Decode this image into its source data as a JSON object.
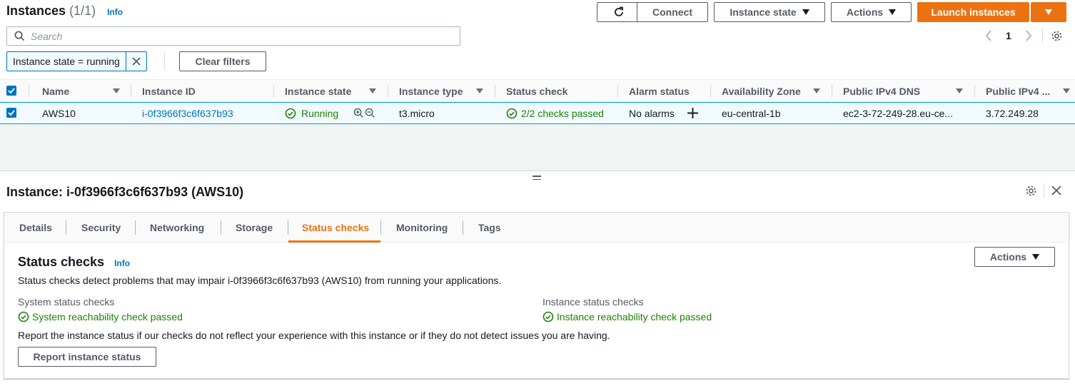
{
  "header": {
    "title": "Instances",
    "count": "(1/1)",
    "info": "Info",
    "connect": "Connect",
    "instance_state": "Instance state",
    "actions": "Actions",
    "launch": "Launch instances"
  },
  "search": {
    "placeholder": "Search"
  },
  "filter": {
    "token": "Instance state = running",
    "clear": "Clear filters"
  },
  "pagination": {
    "page": "1"
  },
  "table": {
    "columns": [
      "Name",
      "Instance ID",
      "Instance state",
      "Instance type",
      "Status check",
      "Alarm status",
      "Availability Zone",
      "Public IPv4 DNS",
      "Public IPv4 ..."
    ],
    "rows": [
      {
        "name": "AWS10",
        "instance_id": "i-0f3966f3c6f637b93",
        "state": "Running",
        "type": "t3.micro",
        "status_check": "2/2 checks passed",
        "alarm": "No alarms",
        "az": "eu-central-1b",
        "dns": "ec2-3-72-249-28.eu-ce...",
        "ipv4": "3.72.249.28"
      }
    ]
  },
  "detail": {
    "title": "Instance: i-0f3966f3c6f637b93 (AWS10)",
    "tabs": [
      "Details",
      "Security",
      "Networking",
      "Storage",
      "Status checks",
      "Monitoring",
      "Tags"
    ],
    "active_tab": "Status checks",
    "section_title": "Status checks",
    "info": "Info",
    "actions": "Actions",
    "description": "Status checks detect problems that may impair i-0f3966f3c6f637b93 (AWS10) from running your applications.",
    "system_label": "System status checks",
    "system_value": "System reachability check passed",
    "instance_label": "Instance status checks",
    "instance_value": "Instance reachability check passed",
    "report_text": "Report the instance status if our checks do not reflect your experience with this instance or if they do not detect issues you are having.",
    "report_button": "Report instance status"
  },
  "colors": {
    "accent": "#ec7211",
    "link": "#0073bb",
    "success": "#1d8102"
  }
}
